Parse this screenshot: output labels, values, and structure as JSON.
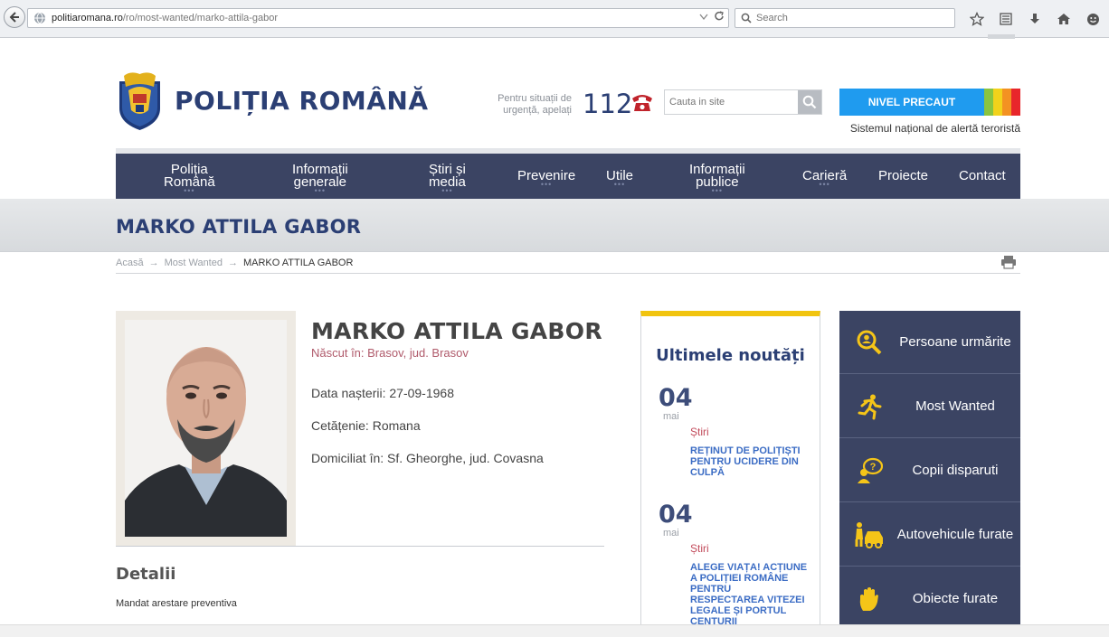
{
  "browser": {
    "url_host": "politiaromana.ro",
    "url_path": "/ro/most-wanted/marko-attila-gabor",
    "search_placeholder": "Search"
  },
  "header": {
    "logo_title": "POLIȚIA ROMÂNĂ",
    "emergency_text": "Pentru situații de urgență, apelați",
    "emergency_number": "112",
    "site_search_placeholder": "Cauta in site",
    "alert_level": "NIVEL PRECAUT",
    "alert_caption": "Sistemul național de alertă teroristă",
    "alert_colors": [
      "#1f9bef",
      "#8ac440",
      "#f2d21b",
      "#f39222",
      "#e8262b"
    ]
  },
  "nav": {
    "items": [
      {
        "label1": "Poliția",
        "label2": "Română",
        "dots": true
      },
      {
        "label1": "Informații",
        "label2": "generale",
        "dots": true
      },
      {
        "label1": "Știri și",
        "label2": "media",
        "dots": true
      },
      {
        "label1": "Prevenire",
        "label2": "",
        "dots": true
      },
      {
        "label1": "Utile",
        "label2": "",
        "dots": true
      },
      {
        "label1": "Informații",
        "label2": "publice",
        "dots": true
      },
      {
        "label1": "Carieră",
        "label2": "",
        "dots": true
      },
      {
        "label1": "Proiecte",
        "label2": "",
        "dots": false
      },
      {
        "label1": "Contact",
        "label2": "",
        "dots": false
      }
    ]
  },
  "page": {
    "title": "MARKO ATTILA GABOR",
    "breadcrumb": [
      "Acasă",
      "Most Wanted",
      "MARKO ATTILA GABOR"
    ]
  },
  "person": {
    "name": "MARKO ATTILA GABOR",
    "born": "Născut în: Brasov, jud. Brasov",
    "birth_date": "Data nașterii: 27-09-1968",
    "citizenship": "Cetățenie: Romana",
    "residence": "Domiciliat în: Sf. Gheorghe, jud. Covasna",
    "details_heading": "Detalii",
    "details_text": "Mandat arestare preventiva"
  },
  "news": {
    "title": "Ultimele noutăți",
    "items": [
      {
        "day": "04",
        "month": "mai",
        "category": "Știri",
        "headline": "REȚINUT DE POLIȚIȘTI PENTRU UCIDERE DIN CULPĂ"
      },
      {
        "day": "04",
        "month": "mai",
        "category": "Știri",
        "headline": "ALEGE VIAȚA! ACȚIUNE A POLIȚIEI ROMÂNE PENTRU RESPECTAREA VITEZEI LEGALE ȘI PORTUL CENTURII"
      }
    ]
  },
  "sidebar": {
    "items": [
      {
        "label": "Persoane urmărite",
        "icon": "magnifier-person-icon"
      },
      {
        "label": "Most Wanted",
        "icon": "running-man-icon"
      },
      {
        "label": "Copii disparuti",
        "icon": "child-bubble-icon"
      },
      {
        "label": "Autovehicule furate",
        "icon": "car-thief-icon"
      },
      {
        "label": "Obiecte furate",
        "icon": "hand-icon"
      }
    ],
    "icon_color": "#f5c518"
  }
}
